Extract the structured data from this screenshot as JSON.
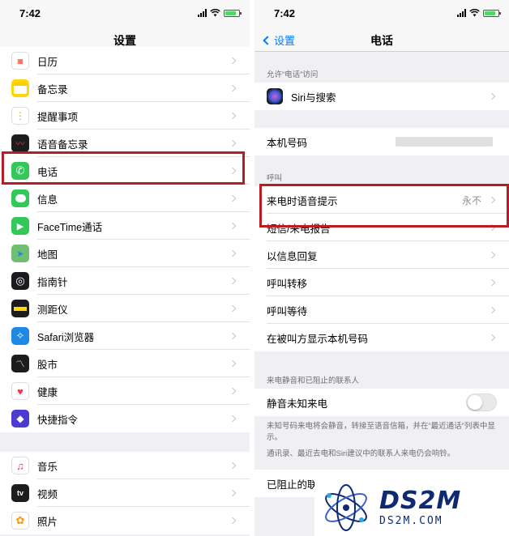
{
  "status": {
    "time": "7:42"
  },
  "settings": {
    "title": "设置",
    "items_group1": [
      {
        "label": "日历",
        "icon": "calendar-icon",
        "color": "#ffffff"
      },
      {
        "label": "备忘录",
        "icon": "notes-icon",
        "color": "#ffd60a"
      },
      {
        "label": "提醒事项",
        "icon": "reminders-icon",
        "color": "#ffffff"
      },
      {
        "label": "语音备忘录",
        "icon": "voice-memos-icon",
        "color": "#1c1c1e"
      },
      {
        "label": "电话",
        "icon": "phone-icon",
        "color": "#34c759"
      },
      {
        "label": "信息",
        "icon": "messages-icon",
        "color": "#34c759"
      },
      {
        "label": "FaceTime通话",
        "icon": "facetime-icon",
        "color": "#34c759"
      },
      {
        "label": "地图",
        "icon": "maps-icon",
        "color": "#6fbf73"
      },
      {
        "label": "指南针",
        "icon": "compass-icon",
        "color": "#1c1c1e"
      },
      {
        "label": "测距仪",
        "icon": "measure-icon",
        "color": "#1c1c1e"
      },
      {
        "label": "Safari浏览器",
        "icon": "safari-icon",
        "color": "#1e88e5"
      },
      {
        "label": "股市",
        "icon": "stocks-icon",
        "color": "#1c1c1e"
      },
      {
        "label": "健康",
        "icon": "health-icon",
        "color": "#ffffff"
      },
      {
        "label": "快捷指令",
        "icon": "shortcuts-icon",
        "color": "#4b3ccf"
      }
    ],
    "items_group2": [
      {
        "label": "音乐",
        "icon": "music-icon",
        "color": "#ffffff"
      },
      {
        "label": "视频",
        "icon": "tv-icon",
        "color": "#1c1c1e"
      },
      {
        "label": "照片",
        "icon": "photos-icon",
        "color": "#ffffff"
      }
    ]
  },
  "phone": {
    "back_label": "设置",
    "title": "电话",
    "section_access": "允许“电话”访问",
    "siri_label": "Siri与搜索",
    "my_number_label": "本机号码",
    "section_calls": "呼叫",
    "announce_calls_label": "来电时语音提示",
    "announce_calls_value": "永不",
    "calls_items": [
      "短信/来电报告",
      "以信息回复",
      "呼叫转移",
      "呼叫等待",
      "在被叫方显示本机号码"
    ],
    "section_silence": "来电静音和已阻止的联系人",
    "silence_label": "静音未知来电",
    "silence_on": false,
    "silence_footer_1": "未知号码来电将会静音，转接至语音信箱，并在“最近通话”列表中显示。",
    "silence_footer_2": "通讯录、最近去电和Siri建议中的联系人来电仍会响铃。",
    "blocked_label": "已阻止的联"
  },
  "watermark": {
    "logo": "DS2M",
    "domain": "DS2M.COM"
  },
  "colors": {
    "highlight": "#b81d24",
    "link": "#007aff",
    "brand": "#0f2a73"
  }
}
